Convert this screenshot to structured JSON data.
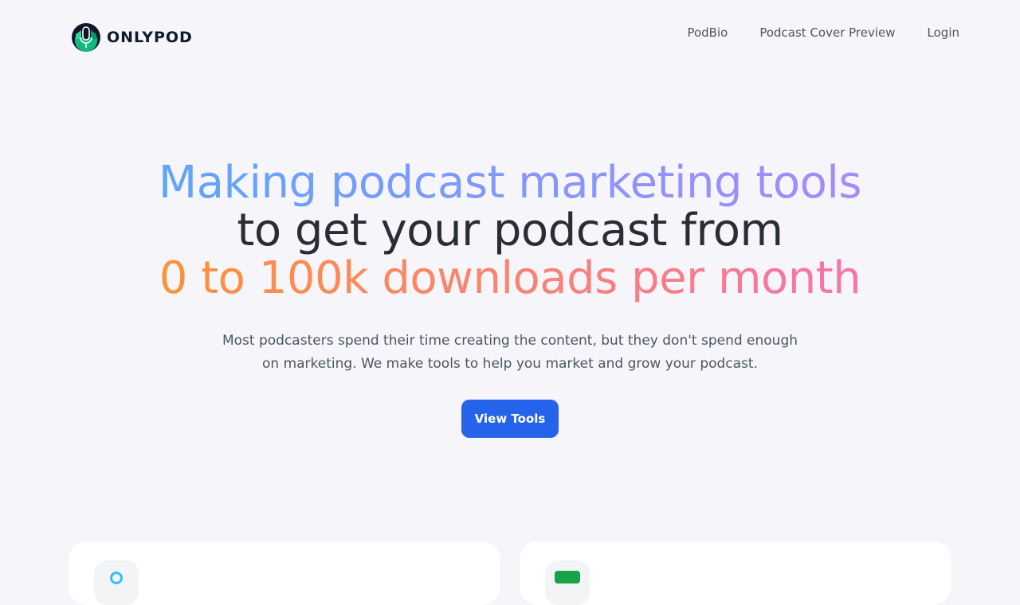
{
  "brand": {
    "name": "ONLYPOD",
    "logo_icon": "microphone-logo-icon"
  },
  "nav": {
    "items": [
      {
        "label": "PodBio"
      },
      {
        "label": "Podcast Cover Preview"
      },
      {
        "label": "Login"
      }
    ]
  },
  "hero": {
    "line1": "Making podcast marketing tools",
    "line2": "to get your podcast from",
    "line3": "0 to 100k downloads per month",
    "subtitle": "Most podcasters spend their time creating the content, but they don't spend enough on marketing. We make tools to help you market and grow your podcast.",
    "cta_label": "View Tools"
  },
  "colors": {
    "background": "#f6f6fa",
    "cta": "#2563eb",
    "gradient_blue_start": "#60a5fa",
    "gradient_blue_end": "#a78bfa",
    "gradient_orange_start": "#fb923c",
    "gradient_orange_end": "#f472b6"
  },
  "cards": [
    {
      "icon": "cyan-circle-icon"
    },
    {
      "icon": "green-square-icon"
    }
  ]
}
